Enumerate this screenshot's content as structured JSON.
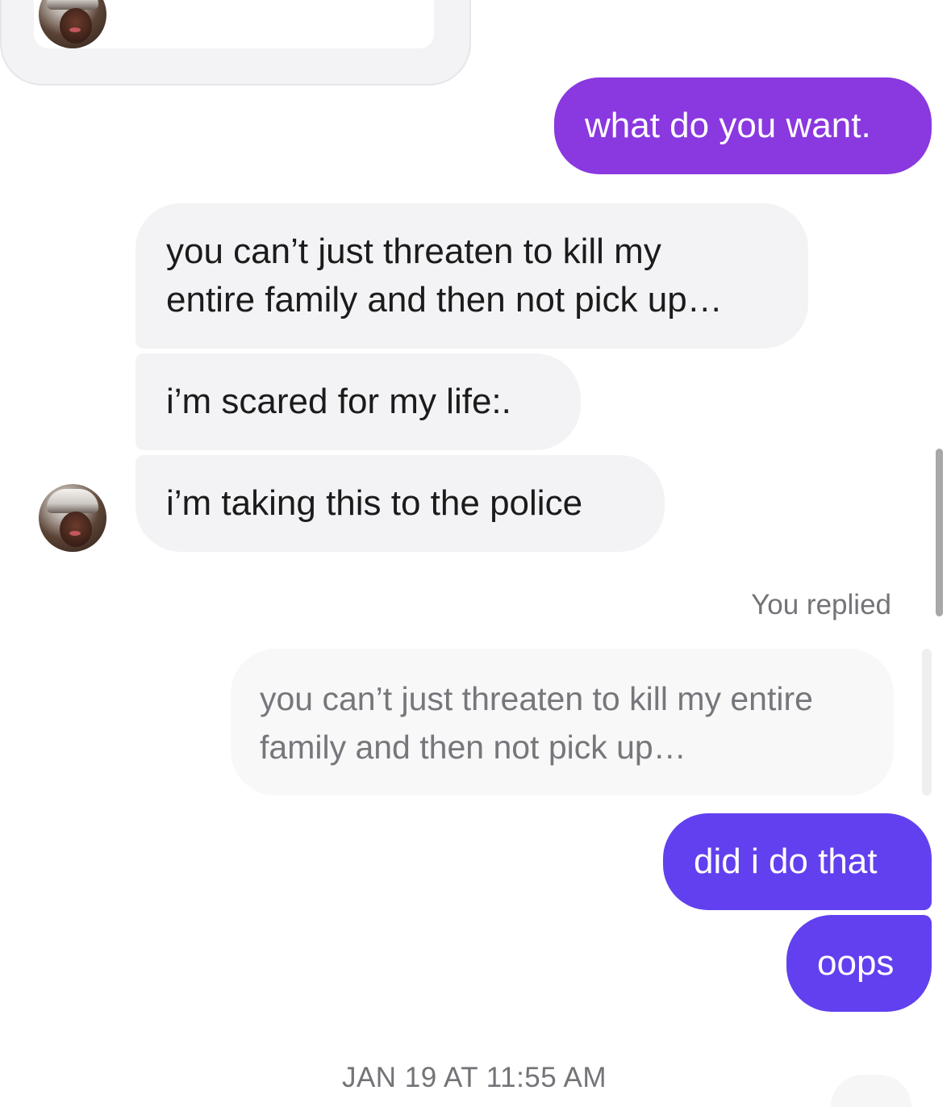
{
  "thread": {
    "messages": [
      {
        "direction": "outgoing",
        "text": "what do you want.",
        "color": "#8A38DF"
      },
      {
        "direction": "incoming",
        "text": "you can’t just threaten to kill my\nentire family and then not pick up…"
      },
      {
        "direction": "incoming",
        "text": "i’m scared for my life:."
      },
      {
        "direction": "incoming",
        "text": "i’m taking this to the police"
      }
    ],
    "reply": {
      "label": "You replied",
      "quoted_text": "you can’t just threaten to kill my entire\nfamily and then not pick up…",
      "messages": [
        {
          "direction": "outgoing",
          "text": "did i do that",
          "color": "#6240EF"
        },
        {
          "direction": "outgoing",
          "text": "oops",
          "color": "#6240EF"
        }
      ]
    },
    "timestamp": "JAN 19 AT 11:55 AM"
  },
  "colors": {
    "incoming_bubble": "#F3F3F5",
    "outgoing_purple": "#8A38DF",
    "outgoing_indigo": "#6240EF",
    "meta_text": "#737378"
  }
}
